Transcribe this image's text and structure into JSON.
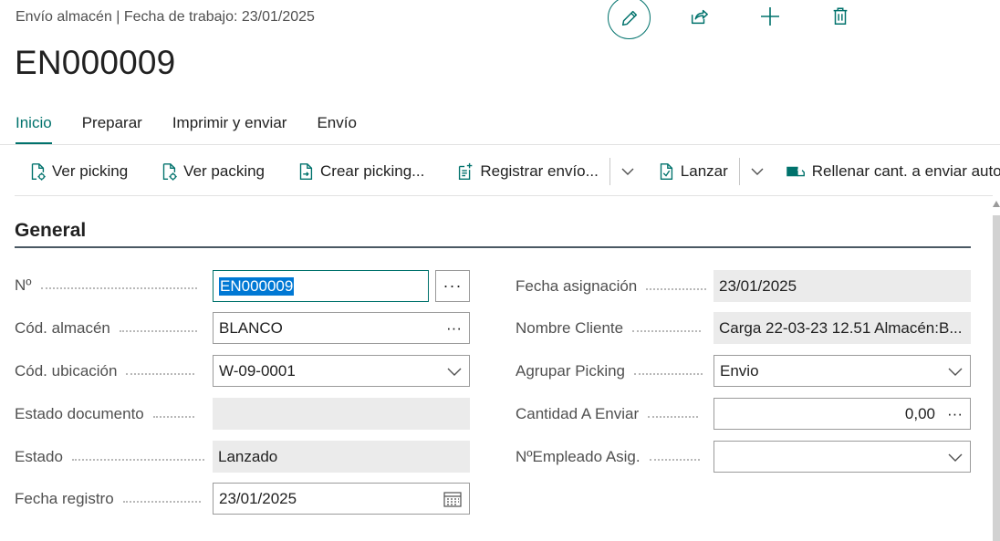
{
  "header": {
    "breadcrumb": "Envío almacén | Fecha de trabajo: 23/01/2025",
    "title": "EN000009",
    "icons": [
      "pencil-icon",
      "share-icon",
      "plus-icon",
      "trash-icon"
    ]
  },
  "tabs": [
    {
      "label": "Inicio",
      "active": true
    },
    {
      "label": "Preparar",
      "active": false
    },
    {
      "label": "Imprimir y enviar",
      "active": false
    },
    {
      "label": "Envío",
      "active": false
    }
  ],
  "actions": {
    "ver_picking": "Ver picking",
    "ver_packing": "Ver packing",
    "crear_picking": "Crear picking...",
    "registrar_envio": "Registrar envío...",
    "lanzar": "Lanzar",
    "rellenar": "Rellenar cant. a enviar auto"
  },
  "section": {
    "title": "General"
  },
  "left_fields": {
    "no": {
      "label": "Nº",
      "value": "EN000009"
    },
    "cod_almacen": {
      "label": "Cód. almacén",
      "value": "BLANCO"
    },
    "cod_ubicacion": {
      "label": "Cód. ubicación",
      "value": "W-09-0001"
    },
    "estado_documento": {
      "label": "Estado documento",
      "value": ""
    },
    "estado": {
      "label": "Estado",
      "value": "Lanzado"
    },
    "fecha_registro": {
      "label": "Fecha registro",
      "value": "23/01/2025"
    }
  },
  "right_fields": {
    "fecha_asignacion": {
      "label": "Fecha asignación",
      "value": "23/01/2025"
    },
    "nombre_cliente": {
      "label": "Nombre Cliente",
      "value": "Carga  22-03-23 12.51 Almacén:B..."
    },
    "agrupar_picking": {
      "label": "Agrupar Picking",
      "value": "Envio"
    },
    "cantidad_a_enviar": {
      "label": "Cantidad A Enviar",
      "value": "0,00"
    },
    "empleado_asig": {
      "label": "NºEmpleado Asig.",
      "value": ""
    }
  },
  "colors": {
    "accent": "#00726c",
    "selection": "#0078d4",
    "readonly_bg": "#ebebeb"
  }
}
